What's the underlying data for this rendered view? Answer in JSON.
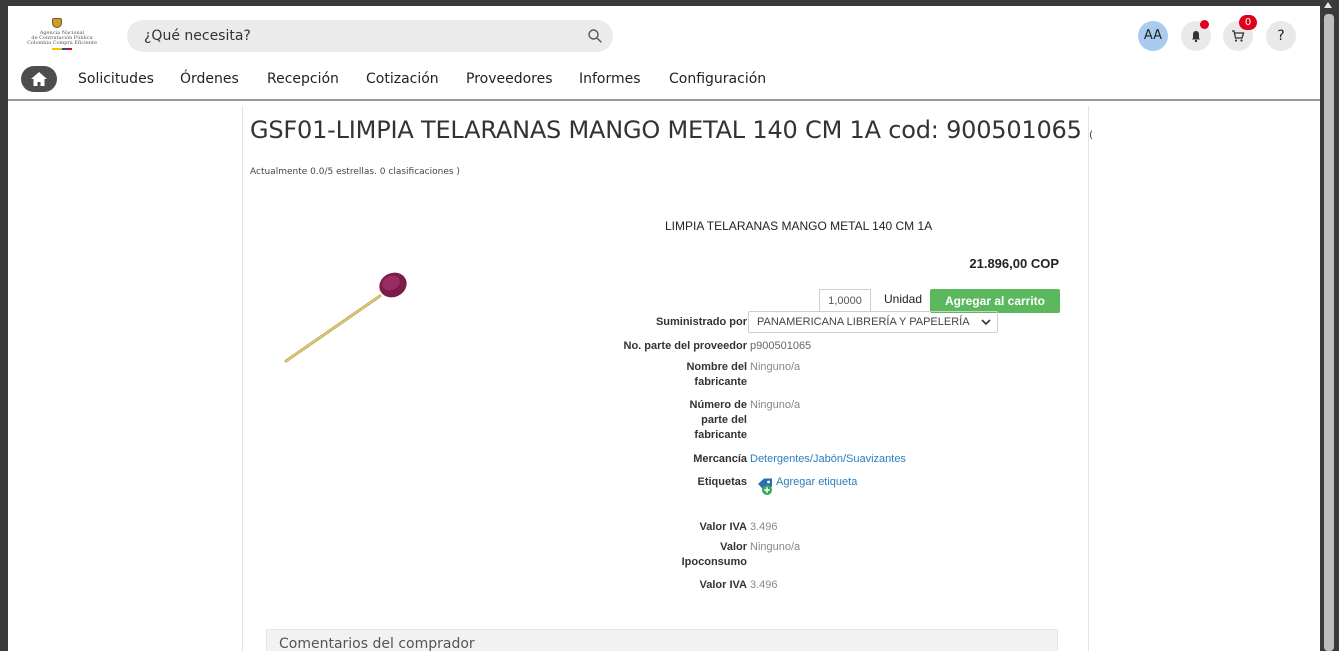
{
  "header": {
    "logo_lines": [
      "Agencia Nacional",
      "de Contratación Pública",
      "Colombia Compra Eficiente"
    ],
    "search_placeholder": "¿Qué necesita?",
    "avatar_initials": "AA",
    "cart_count": "0",
    "help_label": "?"
  },
  "nav": {
    "items": [
      "Solicitudes",
      "Órdenes",
      "Recepción",
      "Cotización",
      "Proveedores",
      "Informes",
      "Configuración"
    ]
  },
  "product": {
    "title": "GSF01-LIMPIA TELARANAS MANGO METAL 140 CM 1A cod: 900501065",
    "title_suffix": "(",
    "rating_text": "Actualmente 0.0/5 estrellas. 0 clasificaciones )",
    "name": "LIMPIA TELARANAS MANGO METAL 140 CM 1A",
    "price": "21.896,00 COP",
    "quantity": "1,0000",
    "unit": "Unidad",
    "add_to_cart_label": "Agregar al carrito",
    "fields": {
      "supplied_by_label": "Suministrado por",
      "supplied_by_value": "PANAMERICANA LIBRERÍA Y PAPELERÍA",
      "supplier_part_label": "No. parte del proveedor",
      "supplier_part_value": "p900501065",
      "manufacturer_label": "Nombre del fabricante",
      "manufacturer_value": "Ninguno/a",
      "manufacturer_part_label": "Número de parte del fabricante",
      "manufacturer_part_value": "Ninguno/a",
      "commodity_label": "Mercancía",
      "commodity_value": "Detergentes/Jabón/Suavizantes",
      "tags_label": "Etiquetas",
      "tags_value": "Agregar etiqueta",
      "iva_label": "Valor IVA",
      "iva_value": "3.496",
      "ipoconsumo_label": "Valor Ipoconsumo",
      "ipoconsumo_value": "Ninguno/a",
      "iva2_label": "Valor IVA",
      "iva2_value": "3.496"
    }
  },
  "comments": {
    "header": "Comentarios del comprador"
  },
  "colors": {
    "primary_button": "#5cb85c",
    "link": "#2a7fc1",
    "badge": "#e0001b",
    "avatar_bg": "#a9cbef"
  },
  "icons": [
    "search-icon",
    "bell-icon",
    "cart-icon",
    "home-icon",
    "chevron-down-icon",
    "tag-add-icon"
  ]
}
